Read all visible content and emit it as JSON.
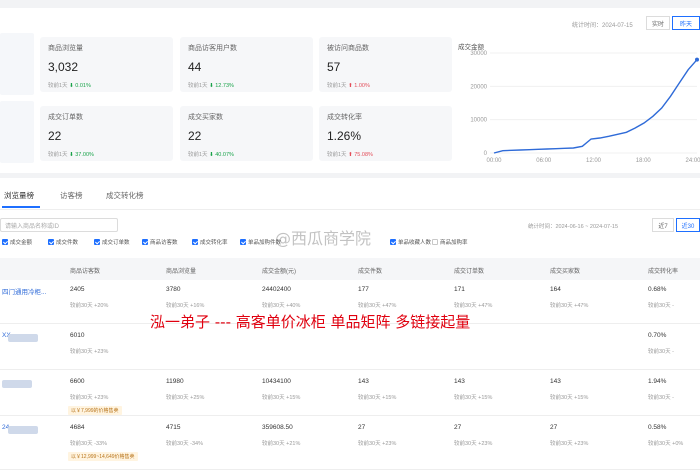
{
  "header": {
    "time_note": "统计时间：2024-07-15",
    "buttons": [
      "实时",
      "昨天"
    ]
  },
  "cards": [
    {
      "title": "商品浏览量",
      "value": "3,032",
      "compare": "较前1天",
      "change": "0.01%",
      "dir": "down"
    },
    {
      "title": "商品访客用户数",
      "value": "44",
      "compare": "较前1天",
      "change": "12.73%",
      "dir": "down"
    },
    {
      "title": "被访问商品数",
      "value": "57",
      "compare": "较前1天",
      "change": "1.00%",
      "dir": "up"
    },
    {
      "title": "成交订单数",
      "value": "22",
      "compare": "较前1天",
      "change": "37.00%",
      "dir": "down"
    },
    {
      "title": "成交买家数",
      "value": "22",
      "compare": "较前1天",
      "change": "40.07%",
      "dir": "down"
    },
    {
      "title": "成交转化率",
      "value": "1.26%",
      "compare": "较前1天",
      "change": "75.08%",
      "dir": "up"
    }
  ],
  "chart_data": {
    "type": "line",
    "title": "成交金额",
    "x": [
      "00:00",
      "06:00",
      "12:00",
      "18:00",
      "24:00"
    ],
    "ticks_y": [
      "0",
      "10000",
      "20000",
      "30000"
    ],
    "ylim": [
      0,
      30000
    ],
    "series": [
      {
        "values": [
          0,
          700,
          800,
          900,
          1000,
          1100,
          1200,
          1300,
          1400,
          1500,
          2000,
          4200,
          4500,
          5000,
          5600,
          6200,
          7500,
          9000,
          11000,
          13500,
          17000,
          21000,
          25000,
          28000
        ]
      }
    ]
  },
  "tabs": [
    "浏览量榜",
    "访客榜",
    "成交转化榜"
  ],
  "filter": {
    "search_placeholder": "请输入商品名称或ID",
    "range": "统计时间：2024-06-16 ~ 2024-07-15",
    "checks": [
      "成交金额",
      "成交件数",
      "成交订单数",
      "商品访客数",
      "成交转化率",
      "单品加购件数",
      "",
      "单品收藏人数",
      "",
      "商品加购率"
    ]
  },
  "table": {
    "headers": [
      "商品访客数",
      "商品浏览量",
      "成交金额(元)",
      "成交件数",
      "成交订单数",
      "成交买家数",
      "成交转化率"
    ],
    "rows": [
      {
        "name": "四门通用冷柜...",
        "cols": [
          [
            "2405",
            "较前30天 +20%"
          ],
          [
            "3780",
            "较前30天 +16%"
          ],
          [
            "24402400",
            "较前30天 +40%"
          ],
          [
            "177",
            "较前30天 +47%"
          ],
          [
            "171",
            "较前30天 +47%"
          ],
          [
            "164",
            "较前30天 +47%"
          ],
          [
            "0.68%",
            "较前30天 -"
          ]
        ]
      },
      {
        "name": "XX",
        "cols": [
          [
            "6010",
            "较前30天 +23%"
          ],
          [
            "",
            ""
          ],
          [
            "",
            ""
          ],
          [
            "",
            ""
          ],
          [
            "",
            ""
          ],
          [
            "",
            ""
          ],
          [
            "0.70%",
            "较前30天 -"
          ]
        ]
      },
      {
        "name": "",
        "cols": [
          [
            "6600",
            "较前30天 +23%"
          ],
          [
            "11980",
            "较前30天 +25%"
          ],
          [
            "10434100",
            "较前30天 +15%"
          ],
          [
            "143",
            "较前30天 +15%"
          ],
          [
            "143",
            "较前30天 +15%"
          ],
          [
            "143",
            "较前30天 +15%"
          ],
          [
            "1.94%",
            "较前30天 -"
          ]
        ]
      },
      {
        "name": "24",
        "cols": [
          [
            "4684",
            "较前30天 -33%"
          ],
          [
            "4715",
            "较前30天 -34%"
          ],
          [
            "359608.50",
            "较前30天 +21%"
          ],
          [
            "27",
            "较前30天 +23%"
          ],
          [
            "27",
            "较前30天 +23%"
          ],
          [
            "27",
            "较前30天 +23%"
          ],
          [
            "0.58%",
            "较前30天 +0%"
          ]
        ]
      }
    ],
    "tags": [
      "以￥7,999的价格售卖",
      "以￥12,999~14,649价格售卖"
    ]
  },
  "overlay_text": "泓一弟子 --- 高客单价冰柜  单品矩阵  多链接起量",
  "watermark_text": "@西瓜商学院"
}
